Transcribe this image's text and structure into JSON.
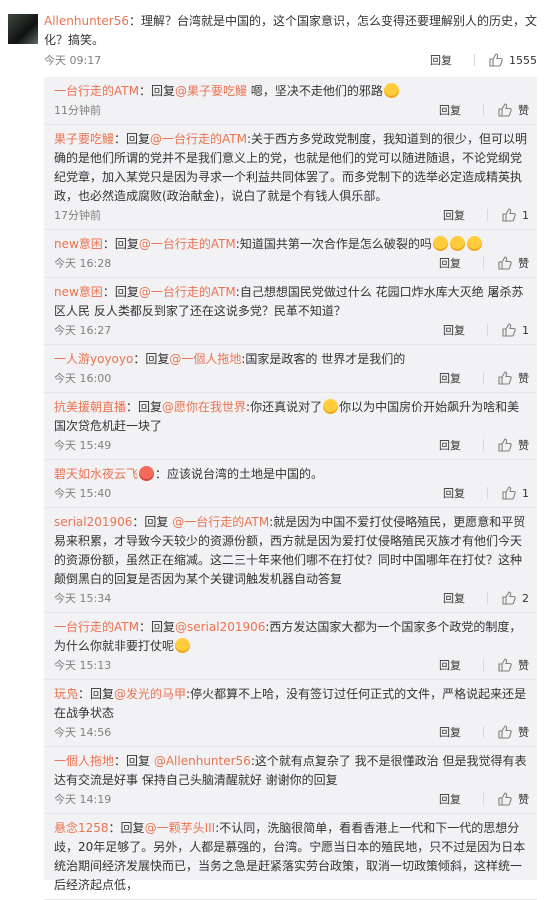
{
  "main_comment": {
    "user": "Allenhunter56",
    "text": "：理解？台湾就是中国的，这个国家意识，怎么变得还要理解别人的历史，文化？搞笑。",
    "time": "今天 09:17",
    "reply_label": "回复",
    "likes": "1555"
  },
  "replies": [
    {
      "user": "一台行走的ATM",
      "prefix": "：回复",
      "target": "@果子要吃鳗",
      "text": " 嗯，坚决不走他们的邪路",
      "emoji": [
        "yellow"
      ],
      "time": "11分钟前",
      "reply_label": "回复",
      "likes": "赞"
    },
    {
      "user": "果子要吃鳗",
      "prefix": "：回复",
      "target": "@一台行走的ATM",
      "text": ":关于西方多党政党制度，我知道到的很少，但可以明确的是他们所谓的党并不是我们意义上的党，也就是他们的党可以随进随退，不论党纲党纪党章，加入某党只是因为寻求一个利益共同体罢了。而多党制下的选举必定造成精英执政，也必然造成腐败(政治献金)，说白了就是个有钱人俱乐部。",
      "emoji": [],
      "time": "17分钟前",
      "reply_label": "回复",
      "likes": "1"
    },
    {
      "user": "new意困",
      "prefix": "：回复",
      "target": "@一台行走的ATM",
      "text": ":知道国共第一次合作是怎么破裂的吗",
      "emoji": [
        "yellow",
        "yellow",
        "yellow"
      ],
      "time": "今天 16:28",
      "reply_label": "回复",
      "likes": "赞"
    },
    {
      "user": "new意困",
      "prefix": "：回复",
      "target": "@一台行走的ATM",
      "text": ":自己想想国民党做过什么 花园口炸水库大灭绝 屠杀苏区人民 反人类都反到家了还在这说多党？民革不知道？",
      "emoji": [],
      "time": "今天 16:27",
      "reply_label": "回复",
      "likes": "1"
    },
    {
      "user": "一人游yoyoyo",
      "prefix": "：回复",
      "target": "@一個人拖地",
      "text": ":国家是政客的 世界才是我们的",
      "emoji": [],
      "time": "今天 16:00",
      "reply_label": "回复",
      "likes": "赞"
    },
    {
      "user": "抗美援朝直播",
      "prefix": "：回复",
      "target": "@愿你在我世界",
      "text": ":你还真说对了",
      "emoji": [
        "yellow"
      ],
      "text2": "你以为中国房价开始飙升为啥和美国次贷危机赶一块了",
      "time": "今天 15:49",
      "reply_label": "回复",
      "likes": "赞"
    },
    {
      "user": "碧天如水夜云飞",
      "prefix": "",
      "target": "",
      "text": "：应该说台湾的土地是中国的。",
      "emoji": [
        "red"
      ],
      "time": "今天 15:40",
      "reply_label": "回复",
      "likes": "1"
    },
    {
      "user": "serial201906",
      "prefix": "：回复 ",
      "target": "@一台行走的ATM",
      "text": ":就是因为中国不爱打仗侵略殖民，更愿意和平贸易来积累，才导致今天较少的资源份额，西方就是因为爱打仗侵略殖民灭族才有他们今天的资源份额，虽然正在缩减。这二三十年来他们哪不在打仗？同时中国哪年在打仗？这种颠倒黑白的回复是否因为某个关键词触发机器自动答复",
      "emoji": [],
      "time": "今天 15:34",
      "reply_label": "回复",
      "likes": "2"
    },
    {
      "user": "一台行走的ATM",
      "prefix": "：回复",
      "target": "@serial201906",
      "text": ":西方发达国家大都为一个国家多个政党的制度，为什么你就非要打仗呢",
      "emoji": [
        "yellow"
      ],
      "time": "今天 15:13",
      "reply_label": "回复",
      "likes": "赞"
    },
    {
      "user": "玩凫",
      "prefix": "：回复",
      "target": "@发光的马甲",
      "text": ":停火都算不上哈，没有签订过任何正式的文件，严格说起来还是在战争状态",
      "emoji": [],
      "time": "今天 14:56",
      "reply_label": "回复",
      "likes": "赞"
    },
    {
      "user": "一個人拖地",
      "prefix": "：回复 ",
      "target": "@Allenhunter56",
      "text": ":这个就有点复杂了 我不是很懂政治 但是我觉得有表达有交流是好事 保持自己头脑清醒就好 谢谢你的回复",
      "emoji": [],
      "time": "今天 14:19",
      "reply_label": "回复",
      "likes": "赞"
    },
    {
      "user": "悬念1258",
      "prefix": "：回复",
      "target": "@一颗芋头III",
      "text": ":不认同，洗脑很简单，看看香港上一代和下一代的思想分歧，20年足够了。另外，人都是慕强的，台湾。宁愿当日本的殖民地，只不过是因为日本统治期间经济发展快而已，当务之急是赶紧落实劳台政策，取消一切政策倾斜，这样统一后经济起点低，",
      "emoji": [],
      "time": "",
      "reply_label": "",
      "likes": ""
    }
  ],
  "colors": {
    "accent": "#eb7350",
    "link": "#eb7350",
    "sub_bg": "#f2f2f5",
    "meta": "#808080"
  },
  "icons": {
    "like": "thumbs-up-icon"
  }
}
